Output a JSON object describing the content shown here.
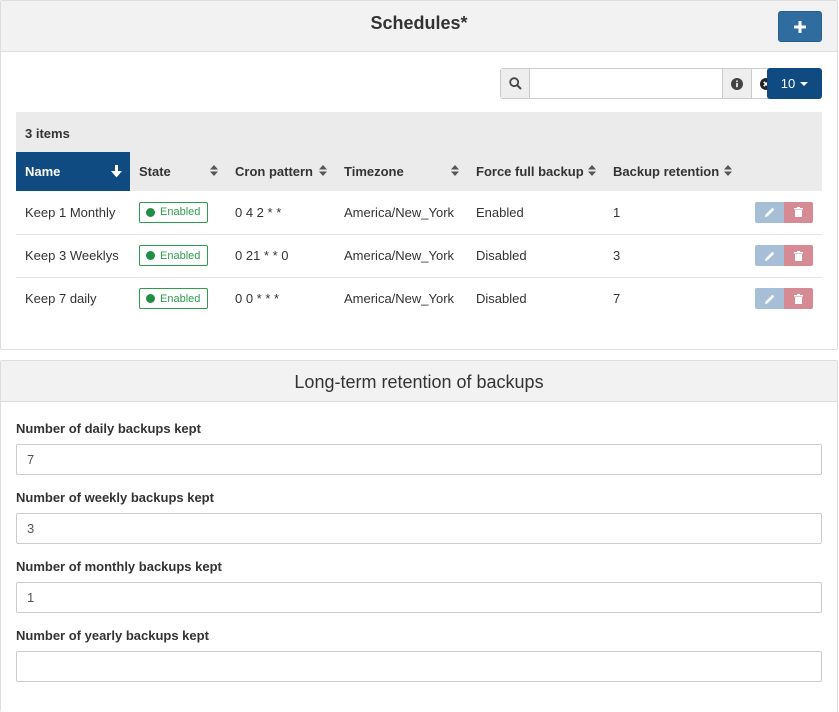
{
  "schedules": {
    "title": "Schedules*",
    "add_icon": "plus-icon",
    "search": {
      "value": "",
      "placeholder": ""
    },
    "page_size": "10",
    "items_count": "3 items",
    "columns": [
      "Name",
      "State",
      "Cron pattern",
      "Timezone",
      "Force full backup",
      "Backup retention"
    ],
    "rows": [
      {
        "name": "Keep 1 Monthly",
        "state": "Enabled",
        "cron": "0 4 2 * *",
        "timezone": "America/New_York",
        "force_full": "Enabled",
        "retention": "1"
      },
      {
        "name": "Keep 3 Weeklys",
        "state": "Enabled",
        "cron": "0 21 * * 0",
        "timezone": "America/New_York",
        "force_full": "Disabled",
        "retention": "3"
      },
      {
        "name": "Keep 7 daily",
        "state": "Enabled",
        "cron": "0 0 * * *",
        "timezone": "America/New_York",
        "force_full": "Disabled",
        "retention": "7"
      }
    ]
  },
  "retention": {
    "title": "Long-term retention of backups",
    "fields": [
      {
        "label": "Number of daily backups kept",
        "value": "7"
      },
      {
        "label": "Number of weekly backups kept",
        "value": "3"
      },
      {
        "label": "Number of monthly backups kept",
        "value": "1"
      },
      {
        "label": "Number of yearly backups kept",
        "value": ""
      }
    ]
  },
  "colors": {
    "primary": "#0f4a80",
    "add_button": "#2f6da0",
    "enabled": "#2e9d4e",
    "edit": "#a6bfd6",
    "delete": "#d68a93"
  }
}
